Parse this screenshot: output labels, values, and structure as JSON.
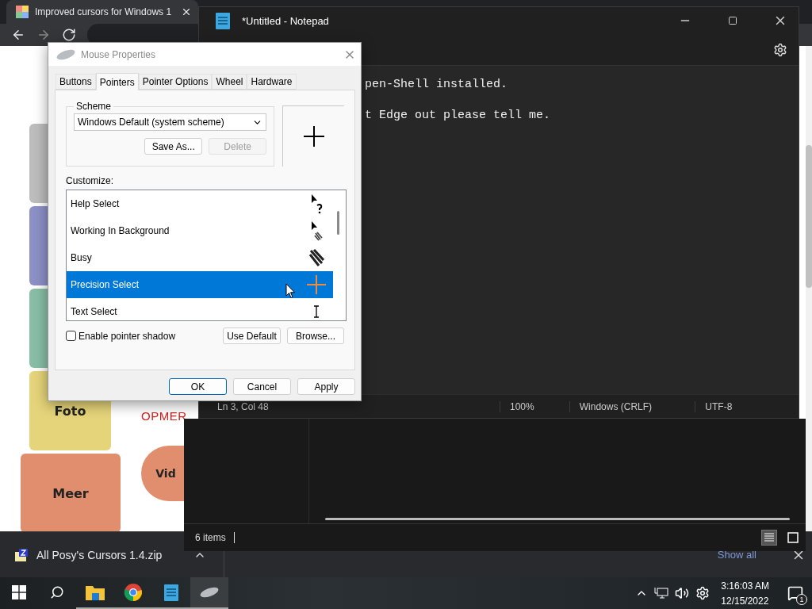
{
  "browser": {
    "tab": {
      "title": "Improved cursors for Windows 1",
      "selected": true
    },
    "page": {
      "tiles": [
        {
          "color": "#bdbdbd"
        },
        {
          "color": "#8d90c6"
        },
        {
          "color": "#89bea6"
        },
        {
          "label": "Foto",
          "color": "#e5d47a"
        }
      ],
      "heading": "OPMER",
      "more_tile": {
        "label": "Meer",
        "color": "#e08e6e"
      },
      "pill": {
        "label": "Vid",
        "color": "#e08e6e"
      }
    }
  },
  "notepad": {
    "title": "*Untitled - Notepad",
    "lines": [
      "pen-Shell installed.",
      "t Edge out please tell me."
    ],
    "status": [
      "Ln 3, Col 48",
      "100%",
      "Windows (CRLF)",
      "UTF-8"
    ]
  },
  "explorer": {
    "items_count": "6 items",
    "views": [
      {
        "kind": "details",
        "selected": true
      },
      {
        "kind": "tiles",
        "selected": false
      }
    ]
  },
  "download_bar": {
    "file": "All Posy's Cursors 1.4.zip",
    "show_all": "Show all"
  },
  "dialog": {
    "title": "Mouse Properties",
    "tabs": [
      {
        "label": "Buttons",
        "selected": false
      },
      {
        "label": "Pointers",
        "selected": true
      },
      {
        "label": "Pointer Options",
        "selected": false
      },
      {
        "label": "Wheel",
        "selected": false
      },
      {
        "label": "Hardware",
        "selected": false
      }
    ],
    "scheme": {
      "label": "Scheme",
      "value": "Windows Default (system scheme)",
      "save_as": "Save As...",
      "delete": {
        "label": "Delete",
        "disabled": true
      }
    },
    "customize_label": "Customize:",
    "pointers": [
      {
        "name": "Help Select",
        "kind": "help",
        "selected": false
      },
      {
        "name": "Working In Background",
        "kind": "working",
        "selected": false
      },
      {
        "name": "Busy",
        "kind": "busy",
        "selected": false
      },
      {
        "name": "Precision Select",
        "kind": "precision",
        "selected": true
      },
      {
        "name": "Text Select",
        "kind": "text",
        "selected": false
      }
    ],
    "shadow": {
      "label": "Enable pointer shadow",
      "checked": false
    },
    "use_default": "Use Default",
    "browse": "Browse...",
    "buttons": [
      {
        "label": "OK",
        "default": true
      },
      {
        "label": "Cancel",
        "default": false
      },
      {
        "label": "Apply",
        "default": false
      }
    ]
  },
  "taskbar": {
    "apps": [
      {
        "kind": "explorer",
        "running": true,
        "active": false
      },
      {
        "kind": "chrome",
        "running": true,
        "active": false
      },
      {
        "kind": "notepad",
        "running": true,
        "active": false
      },
      {
        "kind": "mouse",
        "running": true,
        "active": true
      }
    ],
    "clock": {
      "time": "3:16:03 AM",
      "date": "12/15/2022"
    },
    "notifications": "1"
  }
}
